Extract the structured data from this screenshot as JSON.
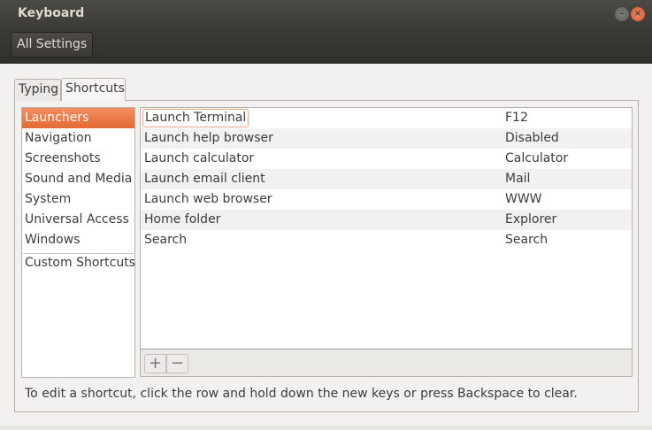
{
  "window": {
    "title": "Keyboard",
    "minimize_glyph": "–",
    "close_glyph": "×"
  },
  "toolbar": {
    "all_settings_label": "All Settings"
  },
  "tabs": [
    {
      "label": "Typing",
      "selected": false
    },
    {
      "label": "Shortcuts",
      "selected": true
    }
  ],
  "categories": {
    "items": [
      {
        "label": "Launchers",
        "selected": true
      },
      {
        "label": "Navigation",
        "selected": false
      },
      {
        "label": "Screenshots",
        "selected": false
      },
      {
        "label": "Sound and Media",
        "selected": false
      },
      {
        "label": "System",
        "selected": false
      },
      {
        "label": "Universal Access",
        "selected": false
      },
      {
        "label": "Windows",
        "selected": false
      }
    ],
    "custom": {
      "label": "Custom Shortcuts"
    }
  },
  "shortcuts": {
    "rows": [
      {
        "action": "Launch Terminal",
        "keys": "F12"
      },
      {
        "action": "Launch help browser",
        "keys": "Disabled"
      },
      {
        "action": "Launch calculator",
        "keys": "Calculator"
      },
      {
        "action": "Launch email client",
        "keys": "Mail"
      },
      {
        "action": "Launch web browser",
        "keys": "WWW"
      },
      {
        "action": "Home folder",
        "keys": "Explorer"
      },
      {
        "action": "Search",
        "keys": "Search"
      }
    ],
    "add_glyph": "+",
    "remove_glyph": "−"
  },
  "hint": "To edit a shortcut, click the row and hold down the new keys or press Backspace to clear.",
  "colors": {
    "accent": "#e36a35",
    "titlebar": "#3c3b37",
    "window_bg": "#f2f1f0"
  }
}
